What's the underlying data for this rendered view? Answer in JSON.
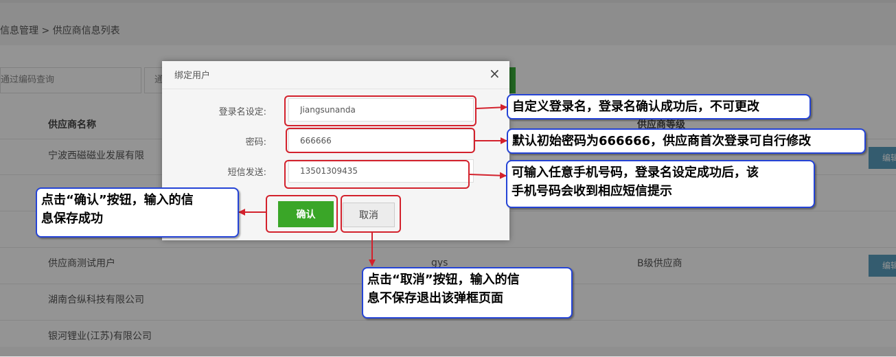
{
  "breadcrumb": "信息管理 > 供应商信息列表",
  "search": {
    "code_placeholder": "通过编码查询",
    "name_placeholder": "通"
  },
  "table": {
    "col_name": "供应商名称",
    "col_level": "供应商等级",
    "rows": [
      {
        "name": "宁波西磁磁业发展有限",
        "code": "",
        "level": "",
        "edit": "编辑"
      },
      {
        "name": "",
        "code": "",
        "level": "",
        "edit": ""
      },
      {
        "name": "",
        "code": "",
        "level": "",
        "edit": ""
      },
      {
        "name": "供应商测试用户",
        "code": "gys",
        "level": "B级供应商",
        "edit": "编辑"
      },
      {
        "name": "湖南合纵科技有限公司",
        "code": "",
        "level": "",
        "edit": ""
      },
      {
        "name": "银河锂业(江苏)有限公司",
        "code": "",
        "level": "",
        "edit": ""
      }
    ]
  },
  "modal": {
    "title": "绑定用户",
    "close_icon": "×",
    "fields": [
      {
        "label": "登录名设定:",
        "value": "Jiangsunanda"
      },
      {
        "label": "密码:",
        "value": "666666"
      },
      {
        "label": "短信发送:",
        "value": "13501309435"
      }
    ],
    "confirm_label": "确认",
    "cancel_label": "取消"
  },
  "annotations": {
    "login_note": "自定义登录名，登录名确认成功后，不可更改",
    "password_note": "默认初始密码为666666，供应商首次登录可自行修改",
    "sms_note_line1": "可输入任意手机号码，登录名设定成功后，该",
    "sms_note_line2": "手机号码会收到相应短信提示",
    "confirm_note_line1": "点击“确认”按钮，输入的信",
    "confirm_note_line2": "息保存成功",
    "cancel_note_line1": "点击“取消”按钮，输入的信",
    "cancel_note_line2": "息不保存退出该弹框页面"
  },
  "colors": {
    "highlight": "#d3212c",
    "callout_border": "#2443d6",
    "confirm_green": "#3aa628"
  }
}
